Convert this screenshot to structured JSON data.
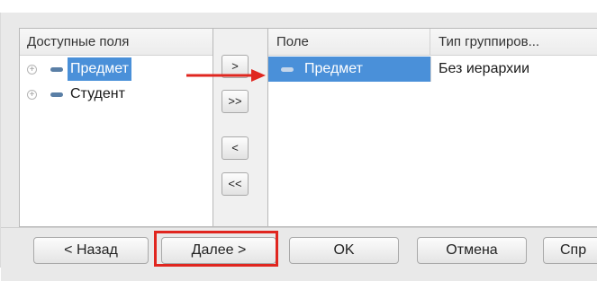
{
  "available_fields": {
    "header": "Доступные поля",
    "items": [
      {
        "label": "Предмет",
        "selected": true
      },
      {
        "label": "Студент",
        "selected": false
      }
    ]
  },
  "move_buttons": {
    "add": ">",
    "add_all": ">>",
    "remove": "<",
    "remove_all": "<<"
  },
  "grouping_table": {
    "columns": [
      "Поле",
      "Тип группиров..."
    ],
    "rows": [
      {
        "field": "Предмет",
        "group_type": "Без иерархии"
      }
    ]
  },
  "footer": {
    "back_label": "< Назад",
    "next_label": "Далее >",
    "ok_label": "OK",
    "cancel_label": "Отмена",
    "help_label": "Спр"
  },
  "colors": {
    "selection": "#4a90d9",
    "annotation_red": "#e0261f",
    "background": "#e9e9e9"
  }
}
